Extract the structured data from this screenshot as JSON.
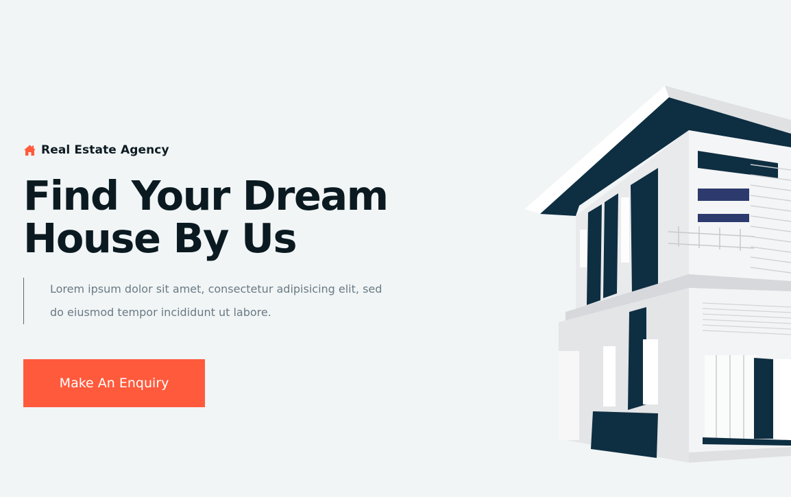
{
  "hero": {
    "tagline": "Real Estate Agency",
    "title_line1": "Find Your Dream",
    "title_line2": "House By Us",
    "description_line1": "Lorem ipsum dolor sit amet, consectetur adipisicing elit, sed",
    "description_line2": "do eiusmod tempor incididunt ut labore.",
    "cta_label": "Make An Enquiry"
  },
  "icons": {
    "tagline": "home-icon",
    "illustration": "house-illustration"
  },
  "colors": {
    "accent": "#ff5a3c",
    "heading": "#0b1a21",
    "body_text": "#6a7a84",
    "background": "#f1f5f6",
    "house_dark": "#0e2e42"
  }
}
